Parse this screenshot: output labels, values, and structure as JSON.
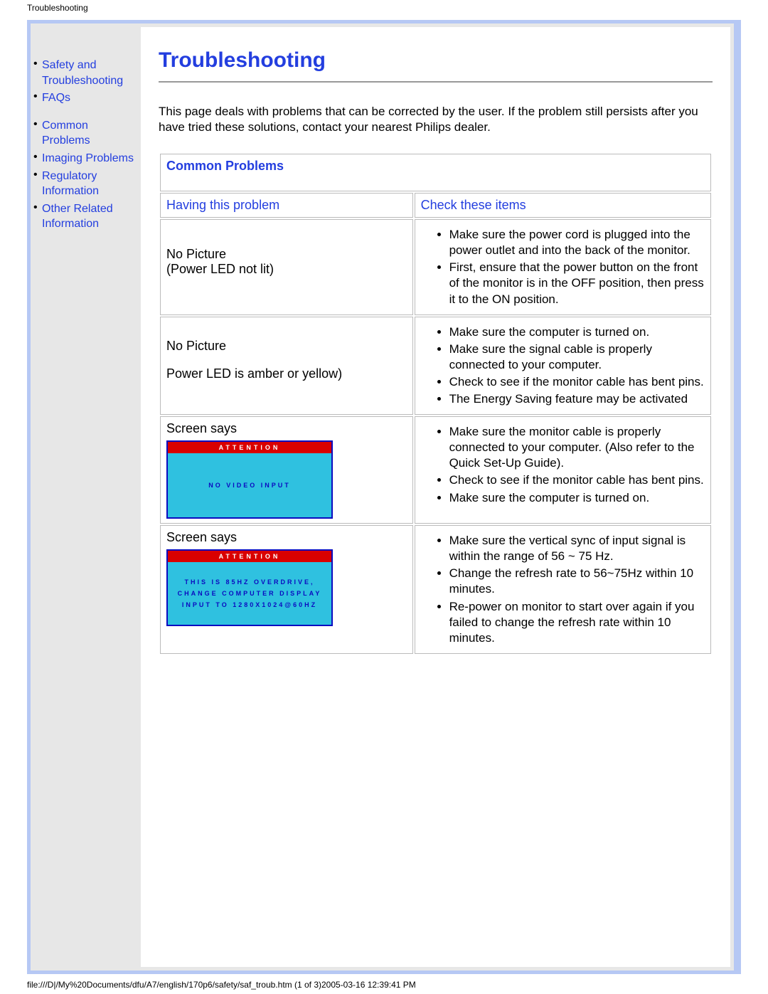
{
  "header": {
    "doc_label": "Troubleshooting"
  },
  "footer": {
    "path": "file:///D|/My%20Documents/dfu/A7/english/170p6/safety/saf_troub.htm (1 of 3)2005-03-16 12:39:41 PM"
  },
  "sidebar": {
    "items": [
      {
        "label": "Safety and Troubleshooting"
      },
      {
        "label": "FAQs"
      },
      {
        "label": "Common Problems"
      },
      {
        "label": "Imaging Problems"
      },
      {
        "label": "Regulatory Information"
      },
      {
        "label": "Other Related Information"
      }
    ]
  },
  "main": {
    "title": "Troubleshooting",
    "intro": "This page deals with problems that can be corrected by the user. If the problem still persists after you have tried these solutions, contact your nearest Philips dealer.",
    "section_title": "Common Problems",
    "col_problem": "Having this problem",
    "col_check": "Check these items",
    "rows": [
      {
        "problem": "No Picture\n(Power LED not lit)",
        "checks": [
          "Make sure the power cord is plugged into the power outlet and into the back of the monitor.",
          "First, ensure that the power button on the front of the monitor is in the OFF position, then press it to the ON position."
        ]
      },
      {
        "problem": "No Picture\n\nPower LED is amber or yellow)",
        "checks": [
          "Make sure the computer is turned on.",
          "Make sure the signal cable is properly connected to your computer.",
          "Check to see if the monitor cable has bent pins.",
          "The Energy Saving feature may be activated"
        ]
      },
      {
        "problem": "Screen says",
        "osd": {
          "title": "ATTENTION",
          "lines": [
            "NO VIDEO INPUT"
          ]
        },
        "checks": [
          "Make sure the monitor cable is properly connected to your computer. (Also refer to the Quick Set-Up Guide).",
          "Check to see if the monitor cable has bent pins.",
          "Make sure the computer is turned on."
        ]
      },
      {
        "problem": "Screen says",
        "osd": {
          "title": "ATTENTION",
          "lines": [
            "THIS IS 85HZ OVERDRIVE,",
            "CHANGE COMPUTER DISPLAY",
            "INPUT TO 1280X1024@60HZ"
          ]
        },
        "checks": [
          "Make sure the vertical sync of input signal is within the range of 56 ~ 75 Hz.",
          "Change the refresh rate to 56~75Hz within 10 minutes.",
          "Re-power on monitor to start over again if you failed to change the refresh rate within 10 minutes."
        ]
      }
    ]
  }
}
